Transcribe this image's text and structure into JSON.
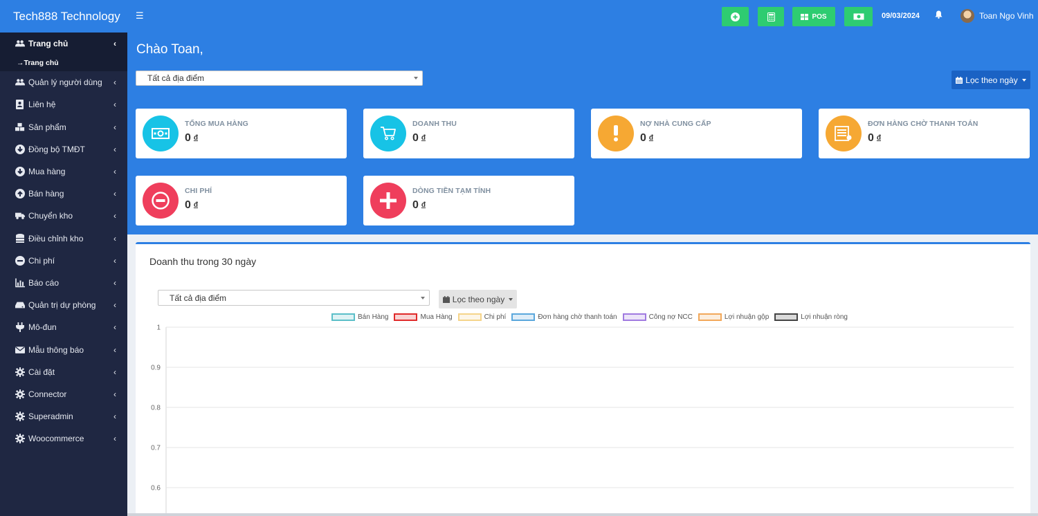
{
  "brand": "Tech888 Technology",
  "sidebar": {
    "items": [
      {
        "label": "Trang chủ",
        "icon": "users-icon",
        "active": true
      },
      {
        "label": "Quản lý người dùng",
        "icon": "users-icon"
      },
      {
        "label": "Liên hệ",
        "icon": "address-book-icon"
      },
      {
        "label": "Sản phẩm",
        "icon": "cubes-icon"
      },
      {
        "label": "Đồng bộ TMĐT",
        "icon": "download-circle-icon"
      },
      {
        "label": "Mua hàng",
        "icon": "download-circle-icon"
      },
      {
        "label": "Bán hàng",
        "icon": "upload-circle-icon"
      },
      {
        "label": "Chuyển kho",
        "icon": "truck-icon"
      },
      {
        "label": "Điều chỉnh kho",
        "icon": "database-icon"
      },
      {
        "label": "Chi phí",
        "icon": "minus-circle-icon"
      },
      {
        "label": "Báo cáo",
        "icon": "bar-chart-icon"
      },
      {
        "label": "Quản trị dự phòng",
        "icon": "hdd-icon"
      },
      {
        "label": "Mô-đun",
        "icon": "plug-icon"
      },
      {
        "label": "Mẫu thông báo",
        "icon": "envelope-icon"
      },
      {
        "label": "Cài đặt",
        "icon": "gear-icon"
      },
      {
        "label": "Connector",
        "icon": "gear-icon"
      },
      {
        "label": "Superadmin",
        "icon": "gear-icon"
      },
      {
        "label": "Woocommerce",
        "icon": "gear-icon"
      }
    ],
    "submenu": "→Trang chủ"
  },
  "topbar": {
    "pos_label": "POS",
    "date": "09/03/2024",
    "user": "Toan Ngo Vinh"
  },
  "main": {
    "greeting": "Chào Toan,",
    "location_select": "Tất cả địa điểm",
    "filter_label": "Lọc theo ngày",
    "cards": [
      {
        "title": "TỔNG MUA HÀNG",
        "value": "0",
        "currency": "đ",
        "color": "#17c3e6",
        "icon": "money-icon"
      },
      {
        "title": "DOANH THU",
        "value": "0",
        "currency": "đ",
        "color": "#17c3e6",
        "icon": "cart-icon"
      },
      {
        "title": "NỢ NHÀ CUNG CẤP",
        "value": "0",
        "currency": "đ",
        "color": "#f6a833",
        "icon": "exclamation-icon"
      },
      {
        "title": "ĐƠN HÀNG CHỜ THANH TOÁN",
        "value": "0",
        "currency": "đ",
        "color": "#f6a833",
        "icon": "invoice-icon"
      },
      {
        "title": "CHI PHÍ",
        "value": "0",
        "currency": "đ",
        "color": "#ef3e5c",
        "icon": "minus-circle-icon"
      },
      {
        "title": "DÒNG TIỀN TẠM TÍNH",
        "value": "0",
        "currency": "đ",
        "color": "#ef3e5c",
        "icon": "plus-icon"
      }
    ]
  },
  "panel": {
    "title": "Doanh thu trong 30 ngày",
    "location_select": "Tất cả địa điểm",
    "filter_label": "Lọc theo ngày"
  },
  "chart_data": {
    "type": "line",
    "title": "",
    "xlabel": "",
    "ylabel": "",
    "ylim": [
      0.6,
      1
    ],
    "yticks": [
      "1",
      "0.9",
      "0.8",
      "0.7",
      "0.6"
    ],
    "series": [
      {
        "name": "Bán Hàng",
        "color": "#5bbfc8",
        "values": []
      },
      {
        "name": "Mua Hàng",
        "color": "#e02a2a",
        "values": []
      },
      {
        "name": "Chi phí",
        "color": "#f5d48a",
        "values": []
      },
      {
        "name": "Đơn hàng chờ thanh toán",
        "color": "#5aa7dc",
        "values": []
      },
      {
        "name": "Công nợ NCC",
        "color": "#a07ae0",
        "values": []
      },
      {
        "name": "Lợi nhuận gộp",
        "color": "#f2a85a",
        "values": []
      },
      {
        "name": "Lợi nhuận ròng",
        "color": "#444444",
        "values": []
      }
    ],
    "grid": true,
    "legend": "top-center"
  }
}
